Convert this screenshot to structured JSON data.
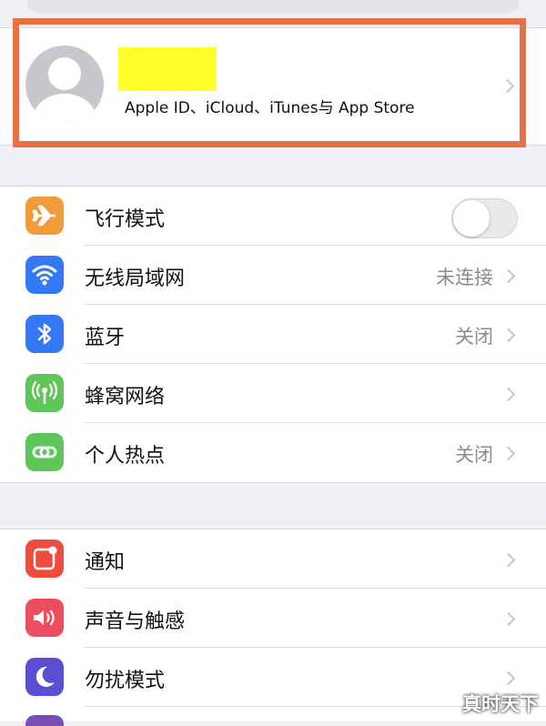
{
  "profile": {
    "subtitle": "Apple ID、iCloud、iTunes与 App Store"
  },
  "settings_group_1": [
    {
      "label": "飞行模式",
      "icon": "airplane-icon",
      "icon_color": "#f29b38",
      "accessory": "toggle",
      "toggle_on": false
    },
    {
      "label": "无线局域网",
      "value": "未连接",
      "icon": "wifi-icon",
      "icon_color": "#3478f6",
      "accessory": "chevron"
    },
    {
      "label": "蓝牙",
      "value": "关闭",
      "icon": "bluetooth-icon",
      "icon_color": "#3478f6",
      "accessory": "chevron"
    },
    {
      "label": "蜂窝网络",
      "icon": "cellular-icon",
      "icon_color": "#5fc65a",
      "accessory": "chevron"
    },
    {
      "label": "个人热点",
      "value": "关闭",
      "icon": "hotspot-icon",
      "icon_color": "#5fc65a",
      "accessory": "chevron"
    }
  ],
  "settings_group_2": [
    {
      "label": "通知",
      "icon": "notifications-icon",
      "icon_color": "#ec4d3f",
      "accessory": "chevron"
    },
    {
      "label": "声音与触感",
      "icon": "sound-icon",
      "icon_color": "#ec4d5f",
      "accessory": "chevron"
    },
    {
      "label": "勿扰模式",
      "icon": "moon-icon",
      "icon_color": "#5a4fd0",
      "accessory": "chevron"
    }
  ],
  "colors": {
    "highlight_border": "#e96f45",
    "redaction": "#ffff2e",
    "background": "#efeff4"
  },
  "watermark": "真时天下"
}
